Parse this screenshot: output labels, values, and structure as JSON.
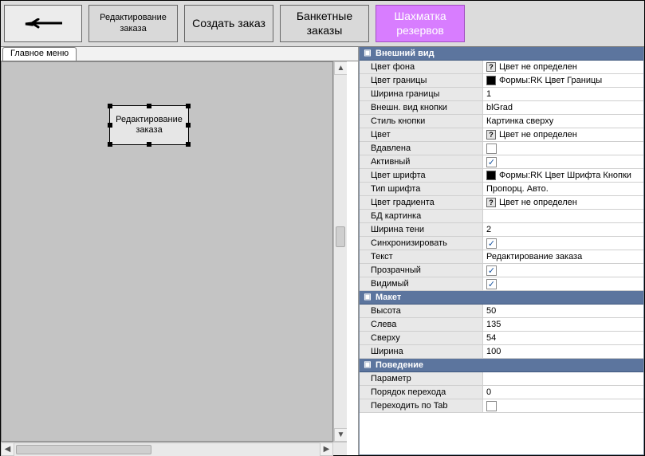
{
  "toolbar": {
    "back_label": "",
    "buttons": [
      {
        "label": "Редактирование заказа"
      },
      {
        "label": "Создать заказ"
      },
      {
        "label": "Банкетные заказы"
      },
      {
        "label": "Шахматка резервов"
      }
    ]
  },
  "tabs": {
    "main": "Главное меню"
  },
  "designer": {
    "selected_text": "Редактирование заказа"
  },
  "section_labels": {
    "appearance": "Внешний вид",
    "layout": "Макет",
    "behavior": "Поведение"
  },
  "props": {
    "bg_color": {
      "name": "Цвет фона",
      "value": "Цвет не определен",
      "kind": "colorq"
    },
    "border_color": {
      "name": "Цвет границы",
      "value": "Формы:RK Цвет Границы",
      "kind": "colorbk"
    },
    "border_width": {
      "name": "Ширина границы",
      "value": "1"
    },
    "btn_look": {
      "name": "Внешн. вид кнопки",
      "value": "blGrad"
    },
    "btn_style": {
      "name": "Стиль кнопки",
      "value": "Картинка сверху"
    },
    "color": {
      "name": "Цвет",
      "value": "Цвет не определен",
      "kind": "colorq"
    },
    "pressed": {
      "name": "Вдавлена",
      "value": false,
      "kind": "bool"
    },
    "active": {
      "name": "Активный",
      "value": true,
      "kind": "bool"
    },
    "font_color": {
      "name": "Цвет шрифта",
      "value": "Формы:RK Цвет Шрифта Кнопки",
      "kind": "colorbk"
    },
    "font_type": {
      "name": "Тип шрифта",
      "value": "Пропорц. Авто."
    },
    "grad_color": {
      "name": "Цвет градиента",
      "value": "Цвет не определен",
      "kind": "colorq"
    },
    "db_image": {
      "name": "БД картинка",
      "value": ""
    },
    "shadow_w": {
      "name": "Ширина тени",
      "value": "2"
    },
    "sync": {
      "name": "Синхронизировать",
      "value": true,
      "kind": "bool"
    },
    "text": {
      "name": "Текст",
      "value": "Редактирование заказа"
    },
    "transparent": {
      "name": "Прозрачный",
      "value": true,
      "kind": "bool"
    },
    "visible": {
      "name": "Видимый",
      "value": true,
      "kind": "bool"
    },
    "height": {
      "name": "Высота",
      "value": "50"
    },
    "left": {
      "name": "Слева",
      "value": "135"
    },
    "top": {
      "name": "Сверху",
      "value": "54"
    },
    "width": {
      "name": "Ширина",
      "value": "100"
    },
    "param": {
      "name": "Параметр",
      "value": ""
    },
    "tab_order": {
      "name": "Порядок перехода",
      "value": "0"
    },
    "tab_stop": {
      "name": "Переходить по Tab",
      "value": false,
      "kind": "bool"
    }
  }
}
